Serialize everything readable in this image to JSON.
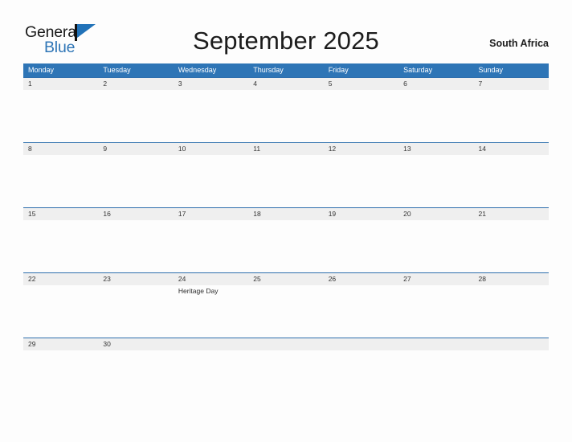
{
  "logo": {
    "word_one": "General",
    "word_two": "Blue",
    "icon": "flag-triangle-icon",
    "color_dark": "#1a1a1a",
    "color_blue": "#2e75b6"
  },
  "header": {
    "title": "September 2025",
    "country": "South Africa"
  },
  "theme": {
    "header_blue": "#2e75b6",
    "band_gray": "#efefef",
    "page_background": "#fdfdfd",
    "text_dark": "#1c1c1c"
  },
  "calendar": {
    "month": "September",
    "year": "2025",
    "weekdays": [
      "Monday",
      "Tuesday",
      "Wednesday",
      "Thursday",
      "Friday",
      "Saturday",
      "Sunday"
    ],
    "weeks": [
      [
        {
          "day": "1",
          "events": []
        },
        {
          "day": "2",
          "events": []
        },
        {
          "day": "3",
          "events": []
        },
        {
          "day": "4",
          "events": []
        },
        {
          "day": "5",
          "events": []
        },
        {
          "day": "6",
          "events": []
        },
        {
          "day": "7",
          "events": []
        }
      ],
      [
        {
          "day": "8",
          "events": []
        },
        {
          "day": "9",
          "events": []
        },
        {
          "day": "10",
          "events": []
        },
        {
          "day": "11",
          "events": []
        },
        {
          "day": "12",
          "events": []
        },
        {
          "day": "13",
          "events": []
        },
        {
          "day": "14",
          "events": []
        }
      ],
      [
        {
          "day": "15",
          "events": []
        },
        {
          "day": "16",
          "events": []
        },
        {
          "day": "17",
          "events": []
        },
        {
          "day": "18",
          "events": []
        },
        {
          "day": "19",
          "events": []
        },
        {
          "day": "20",
          "events": []
        },
        {
          "day": "21",
          "events": []
        }
      ],
      [
        {
          "day": "22",
          "events": []
        },
        {
          "day": "23",
          "events": []
        },
        {
          "day": "24",
          "events": [
            "Heritage Day"
          ]
        },
        {
          "day": "25",
          "events": []
        },
        {
          "day": "26",
          "events": []
        },
        {
          "day": "27",
          "events": []
        },
        {
          "day": "28",
          "events": []
        }
      ],
      [
        {
          "day": "29",
          "events": []
        },
        {
          "day": "30",
          "events": []
        },
        {
          "day": "",
          "events": []
        },
        {
          "day": "",
          "events": []
        },
        {
          "day": "",
          "events": []
        },
        {
          "day": "",
          "events": []
        },
        {
          "day": "",
          "events": []
        }
      ]
    ]
  }
}
